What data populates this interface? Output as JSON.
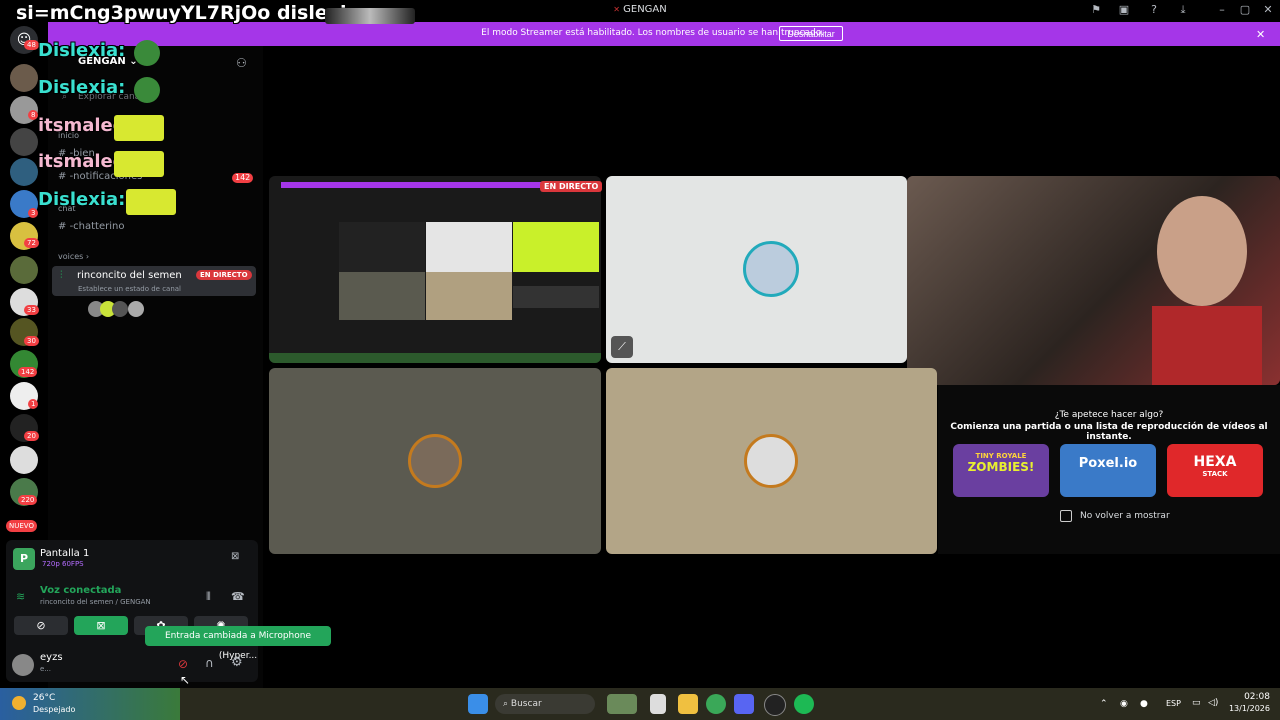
{
  "window": {
    "title": "GENGAN",
    "controls": [
      "flag-icon",
      "monitor-icon",
      "help-icon",
      "download-icon",
      "minimize-icon",
      "maximize-icon",
      "close-icon"
    ]
  },
  "overlay": {
    "title": "si=mCng3pwuyYL7RjOo dislexia",
    "messages": [
      {
        "user": "Dislexia:",
        "color": "#3ae0d0"
      },
      {
        "user": "Dislexia:",
        "color": "#3ae0d0"
      },
      {
        "user": "itsmalee:",
        "color": "#f4b8d0"
      },
      {
        "user": "itsmalee:",
        "color": "#f4b8d0"
      },
      {
        "user": "Dislexia:",
        "color": "#3ae0d0"
      }
    ]
  },
  "banner": {
    "text": "El modo Streamer está habilitado. Los nombres de usuario se han truncado.",
    "button": "Deshabilitar",
    "color": "#a536e8"
  },
  "rail": {
    "badges": [
      "48",
      "8",
      "3",
      "72",
      "33",
      "30",
      "142",
      "1",
      "20",
      "220"
    ],
    "new_label": "NUEVO"
  },
  "sidebar": {
    "server_name": "GENGAN",
    "search_placeholder": "Explorar canales",
    "category_inicio": "inicio",
    "channel_1": "-bien",
    "channel_2": "-notificaciones",
    "channel_2_badge": "142",
    "category_chat": "chat",
    "channel_3": "-chatterino",
    "category_voices": "voices",
    "voice_channel": "rinconcito del semen",
    "voice_live": "EN DIRECTO",
    "voice_status": "Establece un estado de canal"
  },
  "stage": {
    "live_badge": "EN DIRECTO"
  },
  "activities": {
    "title": "¿Te apetece hacer algo?",
    "subtitle": "Comienza una partida o una lista de reproducción de vídeos al instante.",
    "games": [
      {
        "name": "ZOMBIES!",
        "top": "TINY ROYALE",
        "color": "#6a3fa0"
      },
      {
        "name": "Poxel.io",
        "top": "",
        "color": "#3a7ac8"
      },
      {
        "name": "HEXA",
        "top": "STACK",
        "color": "#e0282a"
      }
    ],
    "checkbox_label": "No volver a mostrar"
  },
  "screen_share": {
    "title": "Pantalla 1",
    "quality": "720p 60FPS"
  },
  "voice": {
    "status": "Voz conectada",
    "channel": "rinconcito del semen / GENGAN"
  },
  "toast": "Entrada cambiada a Microphone (Hyper...",
  "user": {
    "name": "eyzs",
    "status": "e..."
  },
  "taskbar": {
    "weather_temp": "26°C",
    "weather_desc": "Despejado",
    "search": "Buscar",
    "lang": "ESP",
    "time": "02:08",
    "date": "13/1/2026"
  }
}
